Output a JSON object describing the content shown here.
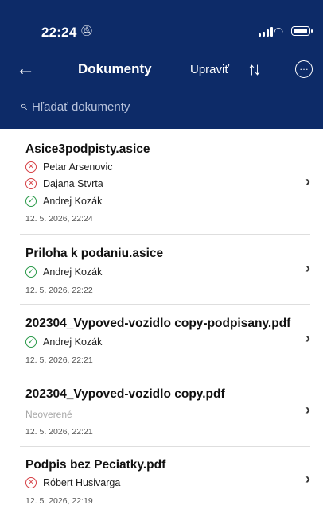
{
  "status": {
    "time": "22:24",
    "muted_icon": "bell-slash-icon"
  },
  "nav": {
    "back_icon": "arrow-left-icon",
    "title": "Dokumenty",
    "edit_label": "Upraviť",
    "sort_icon": "sort-arrows-icon",
    "more_icon": "ellipsis-circle-icon"
  },
  "search": {
    "placeholder": "Hľadať dokumenty"
  },
  "colors": {
    "header": "#0d2b68",
    "invalid": "#d64045",
    "valid": "#2b9a4a"
  },
  "documents": [
    {
      "name": "Asice3podpisty.asice",
      "signers": [
        {
          "name": "Petar Arsenovic",
          "status": "invalid"
        },
        {
          "name": "Dajana Stvrta",
          "status": "invalid"
        },
        {
          "name": "Andrej Kozák",
          "status": "valid"
        }
      ],
      "date": "12. 5. 2026, 22:24"
    },
    {
      "name": "Priloha k podaniu.asice",
      "signers": [
        {
          "name": "Andrej Kozák",
          "status": "valid"
        }
      ],
      "date": "12. 5. 2026, 22:22"
    },
    {
      "name": "202304_Vypoved-vozidlo copy-podpisany.pdf",
      "signers": [
        {
          "name": "Andrej Kozák",
          "status": "valid"
        }
      ],
      "date": "12. 5. 2026, 22:21"
    },
    {
      "name": "202304_Vypoved-vozidlo copy.pdf",
      "unverified": "Neoverené",
      "date": "12. 5. 2026, 22:21"
    },
    {
      "name": "Podpis bez Peciatky.pdf",
      "signers": [
        {
          "name": "Róbert Husivarga",
          "status": "invalid"
        }
      ],
      "date": "12. 5. 2026, 22:19"
    }
  ]
}
